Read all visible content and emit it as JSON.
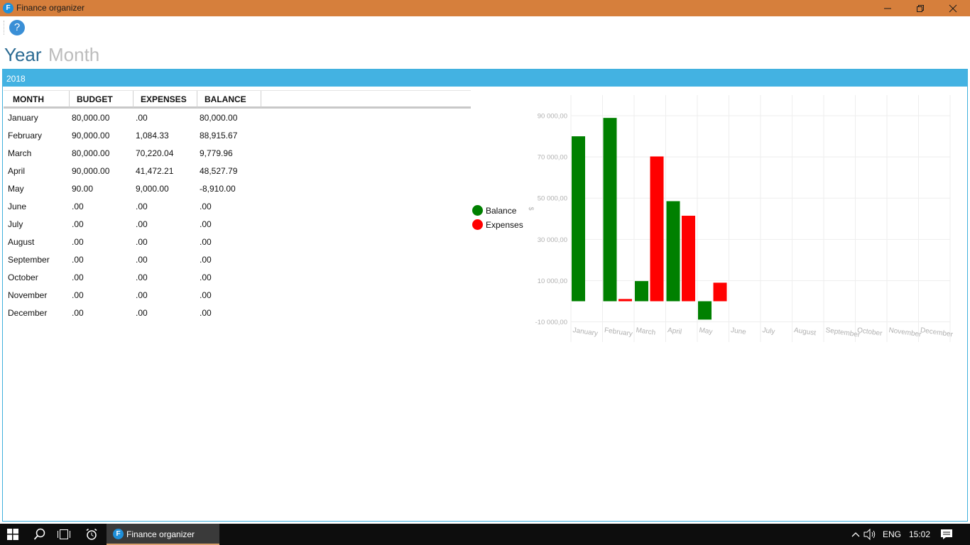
{
  "window": {
    "title": "Finance organizer",
    "icon_letter": "F"
  },
  "toolbar": {
    "help_icon": "?"
  },
  "tabs": [
    {
      "label": "Year",
      "active": true
    },
    {
      "label": "Month",
      "active": false
    }
  ],
  "panel": {
    "year": "2018"
  },
  "table": {
    "columns": [
      "MONTH",
      "BUDGET",
      "EXPENSES",
      "BALANCE"
    ],
    "rows": [
      [
        "January",
        "80,000.00",
        ".00",
        "80,000.00"
      ],
      [
        "February",
        "90,000.00",
        "1,084.33",
        "88,915.67"
      ],
      [
        "March",
        "80,000.00",
        "70,220.04",
        "9,779.96"
      ],
      [
        "April",
        "90,000.00",
        "41,472.21",
        "48,527.79"
      ],
      [
        "May",
        "90.00",
        "9,000.00",
        "-8,910.00"
      ],
      [
        "June",
        ".00",
        ".00",
        ".00"
      ],
      [
        "July",
        ".00",
        ".00",
        ".00"
      ],
      [
        "August",
        ".00",
        ".00",
        ".00"
      ],
      [
        "September",
        ".00",
        ".00",
        ".00"
      ],
      [
        "October",
        ".00",
        ".00",
        ".00"
      ],
      [
        "November",
        ".00",
        ".00",
        ".00"
      ],
      [
        "December",
        ".00",
        ".00",
        ".00"
      ]
    ]
  },
  "chart_data": {
    "type": "bar",
    "categories": [
      "January",
      "February",
      "March",
      "April",
      "May",
      "June",
      "July",
      "August",
      "September",
      "October",
      "November",
      "December"
    ],
    "series": [
      {
        "name": "Balance",
        "color": "#008000",
        "values": [
          80000,
          88915.67,
          9779.96,
          48527.79,
          -8910,
          0,
          0,
          0,
          0,
          0,
          0,
          0
        ]
      },
      {
        "name": "Expenses",
        "color": "#ff0000",
        "values": [
          0,
          1084.33,
          70220.04,
          41472.21,
          9000,
          0,
          0,
          0,
          0,
          0,
          0,
          0
        ]
      }
    ],
    "yticks": [
      -10000,
      10000,
      30000,
      50000,
      70000,
      90000
    ],
    "ytick_labels": [
      "-10 000,00",
      "10 000,00",
      "30 000,00",
      "50 000,00",
      "70 000,00",
      "90 000,00"
    ],
    "ylim": [
      -10000,
      100000
    ],
    "ylabel": "$",
    "grid": true,
    "legend": "left"
  },
  "taskbar": {
    "app_label": "Finance organizer",
    "language": "ENG",
    "time": "15:02"
  }
}
